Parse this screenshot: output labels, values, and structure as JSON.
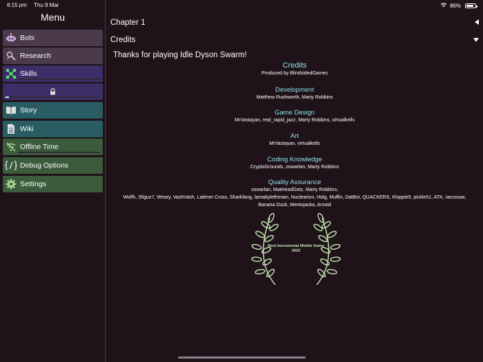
{
  "status": {
    "time": "6:15 pm",
    "date": "Thu 9 Mar",
    "battery": "86%",
    "battery_level": 0.86
  },
  "sidebar": {
    "title": "Menu",
    "items": [
      {
        "label": "Bots",
        "bg": "#4a3a4c",
        "icon": "robot-icon"
      },
      {
        "label": "Research",
        "bg": "#4a3a4c",
        "icon": "research-icon"
      },
      {
        "label": "Skills",
        "bg": "#3c2e68",
        "icon": "skills-icon",
        "progress": 0.0
      },
      {
        "label": "",
        "bg": "#3c2e68",
        "icon": "lock-icon",
        "progress": 0.04
      },
      {
        "label": "Story",
        "bg": "#2a5d63",
        "icon": "book-icon"
      },
      {
        "label": "Wiki",
        "bg": "#2a5d63",
        "icon": "document-icon"
      },
      {
        "label": "Offline Time",
        "bg": "#3b5b3d",
        "icon": "wifi-off-icon",
        "progress": 0.0
      },
      {
        "label": "Debug Options",
        "bg": "#3b5b3d",
        "icon": "code-icon"
      },
      {
        "label": "Settings",
        "bg": "#3b5b3d",
        "icon": "gear-icon"
      }
    ]
  },
  "main": {
    "chapter": "Chapter 1",
    "credits_header": "Credits",
    "thanks": "Thanks for playing Idle Dyson Swarm!",
    "credits": {
      "title": "Credits",
      "produced_by": "Produced by BlindsidedGames",
      "sections": [
        {
          "heading": "Development",
          "names": [
            "Matthew Rushworth, Marty Robbins"
          ]
        },
        {
          "heading": "Game Design",
          "names": [
            "MrVastayan, real_rapid_jazz, Marty Robbins, virtualkells"
          ]
        },
        {
          "heading": "Art",
          "names": [
            "MrVastayan, virtualkells"
          ]
        },
        {
          "heading": "Coding Knowledge",
          "names": [
            "CryptoGrounds, oswarlan, Marty Robbins"
          ]
        },
        {
          "heading": "Quality Assurance",
          "names": [
            "oswarlan, MatHeadGetz, Marty Robbins,",
            "Wolfh, Sfiguz7, Weary, VashVash, Latimer Cross, Sharkfang, lamabylethmain, Nuclearion, Holg, Muffin, DatBoi, QUACKERS, Kloppie5, pickle51, ATK, racsosax,",
            "Banana Duck, Mentojacka, Arnoid"
          ]
        }
      ]
    },
    "award": {
      "line1": "Best Incremental Mobile Game",
      "line2": "2022",
      "color": "#c8ecb6"
    }
  },
  "colors": {
    "background": "#1f1219",
    "accent": "#8fe3ea"
  }
}
